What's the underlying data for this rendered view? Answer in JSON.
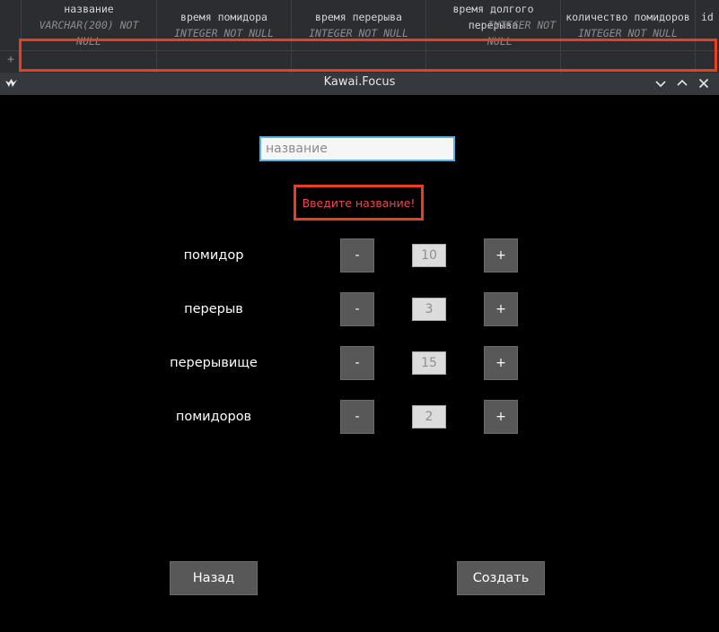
{
  "db_table": {
    "add_row_label": "+",
    "columns": [
      {
        "name": "название",
        "type": "VARCHAR(200) NOT NULL"
      },
      {
        "name": "время помидора",
        "type": "INTEGER NOT NULL"
      },
      {
        "name": "время перерыва",
        "type": "INTEGER NOT NULL"
      },
      {
        "name": "время долгого перерыва",
        "type": "INTEGER NOT NULL"
      },
      {
        "name": "количество помидоров",
        "type": "INTEGER NOT NULL"
      },
      {
        "name": "id",
        "type": ""
      }
    ]
  },
  "window": {
    "title": "Kawai.Focus",
    "icon": "kivy-logo-icon",
    "controls": [
      "minimize-icon",
      "maximize-icon",
      "close-icon"
    ]
  },
  "form": {
    "name_placeholder": "название",
    "name_value": "",
    "error_message": "Введите название!",
    "rows": [
      {
        "label": "помидор",
        "value": "10",
        "minus": "-",
        "plus": "+"
      },
      {
        "label": "перерыв",
        "value": "3",
        "minus": "-",
        "plus": "+"
      },
      {
        "label": "перерывище",
        "value": "15",
        "minus": "-",
        "plus": "+"
      },
      {
        "label": "помидоров",
        "value": "2",
        "minus": "-",
        "plus": "+"
      }
    ],
    "back_label": "Назад",
    "create_label": "Создать"
  },
  "colors": {
    "highlight": "#e8401c",
    "error_text": "#f2454f",
    "input_focus": "#55b2e3",
    "button_bg": "#585858"
  }
}
